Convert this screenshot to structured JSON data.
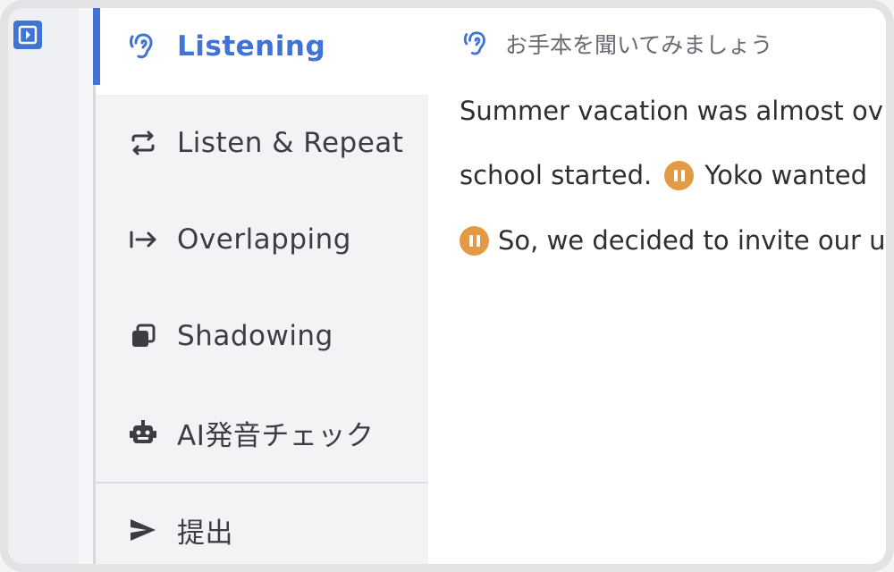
{
  "rail": {
    "toggle_icon": "sidebar-toggle-icon"
  },
  "sidebar": {
    "items": [
      {
        "label": "Listening",
        "icon": "ear-icon",
        "active": true
      },
      {
        "label": "Listen & Repeat",
        "icon": "repeat-icon",
        "active": false
      },
      {
        "label": "Overlapping",
        "icon": "arrow-right-bar-icon",
        "active": false
      },
      {
        "label": "Shadowing",
        "icon": "copy-icon",
        "active": false
      },
      {
        "label": "AI発音チェック",
        "icon": "robot-icon",
        "active": false
      },
      {
        "label": "提出",
        "icon": "send-icon",
        "active": false
      }
    ]
  },
  "content": {
    "header": {
      "icon": "ear-icon",
      "text": "お手本を聞いてみましょう"
    },
    "lines": [
      {
        "before": "Summer vacation was almost ov",
        "after": ""
      },
      {
        "before": "school started.",
        "after": "Yoko wanted"
      },
      {
        "before": "",
        "after": "So, we decided to invite our ur"
      }
    ]
  },
  "colors": {
    "accent": "#3f73d6",
    "pause": "#e29a45",
    "text": "#2e2e33"
  }
}
